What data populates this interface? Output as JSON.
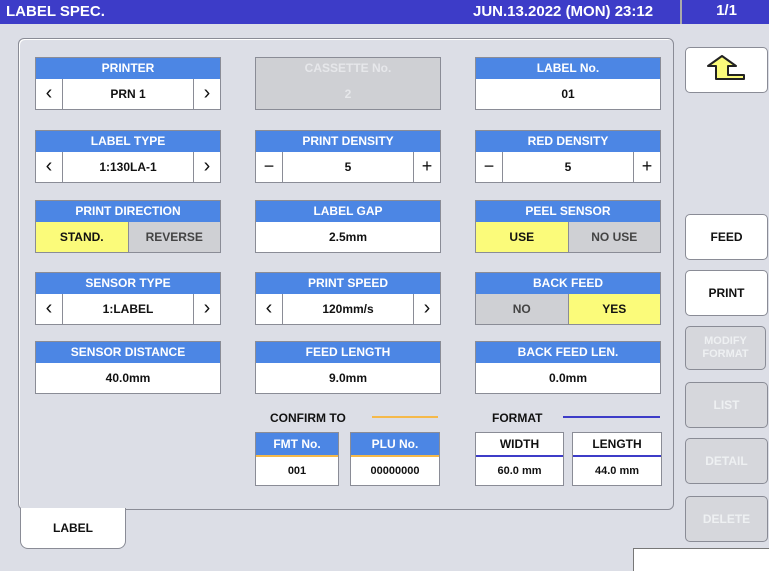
{
  "title": "LABEL SPEC.",
  "datetime": "JUN.13.2022 (MON)  23:12",
  "page": "1/1",
  "fields": {
    "printer": {
      "label": "PRINTER",
      "value": "PRN 1"
    },
    "cassette": {
      "label": "CASSETTE No.",
      "value": "2"
    },
    "label_no": {
      "label": "LABEL No.",
      "value": "01"
    },
    "label_type": {
      "label": "LABEL TYPE",
      "value": "1:130LA-1"
    },
    "print_density": {
      "label": "PRINT DENSITY",
      "value": "5"
    },
    "red_density": {
      "label": "RED DENSITY",
      "value": "5"
    },
    "print_direction": {
      "label": "PRINT DIRECTION",
      "opt1": "STAND.",
      "opt2": "REVERSE"
    },
    "label_gap": {
      "label": "LABEL GAP",
      "value": "2.5mm"
    },
    "peel_sensor": {
      "label": "PEEL SENSOR",
      "opt1": "USE",
      "opt2": "NO USE"
    },
    "sensor_type": {
      "label": "SENSOR TYPE",
      "value": "1:LABEL"
    },
    "print_speed": {
      "label": "PRINT SPEED",
      "value": "120mm/s"
    },
    "back_feed": {
      "label": "BACK FEED",
      "opt1": "NO",
      "opt2": "YES"
    },
    "sensor_distance": {
      "label": "SENSOR DISTANCE",
      "value": "40.0mm"
    },
    "feed_length": {
      "label": "FEED LENGTH",
      "value": "9.0mm"
    },
    "back_feed_len": {
      "label": "BACK FEED LEN.",
      "value": "0.0mm"
    }
  },
  "confirm": {
    "label": "CONFIRM TO",
    "fmt_label": "FMT No.",
    "fmt_value": "001",
    "plu_label": "PLU No.",
    "plu_value": "00000000"
  },
  "format": {
    "label": "FORMAT",
    "width_label": "WIDTH",
    "width_value": "60.0 mm",
    "length_label": "LENGTH",
    "length_value": "44.0 mm"
  },
  "tab": "LABEL",
  "side": {
    "feed": "FEED",
    "print": "PRINT",
    "modify": "MODIFY FORMAT",
    "list": "LIST",
    "detail": "DETAIL",
    "delete": "DELETE"
  },
  "colors": {
    "title_bar": "#3d3cc8",
    "header": "#4c86e4",
    "selected": "#fbfb7a",
    "confirm_line": "#f5a623",
    "format_line": "#3d3cc8"
  }
}
